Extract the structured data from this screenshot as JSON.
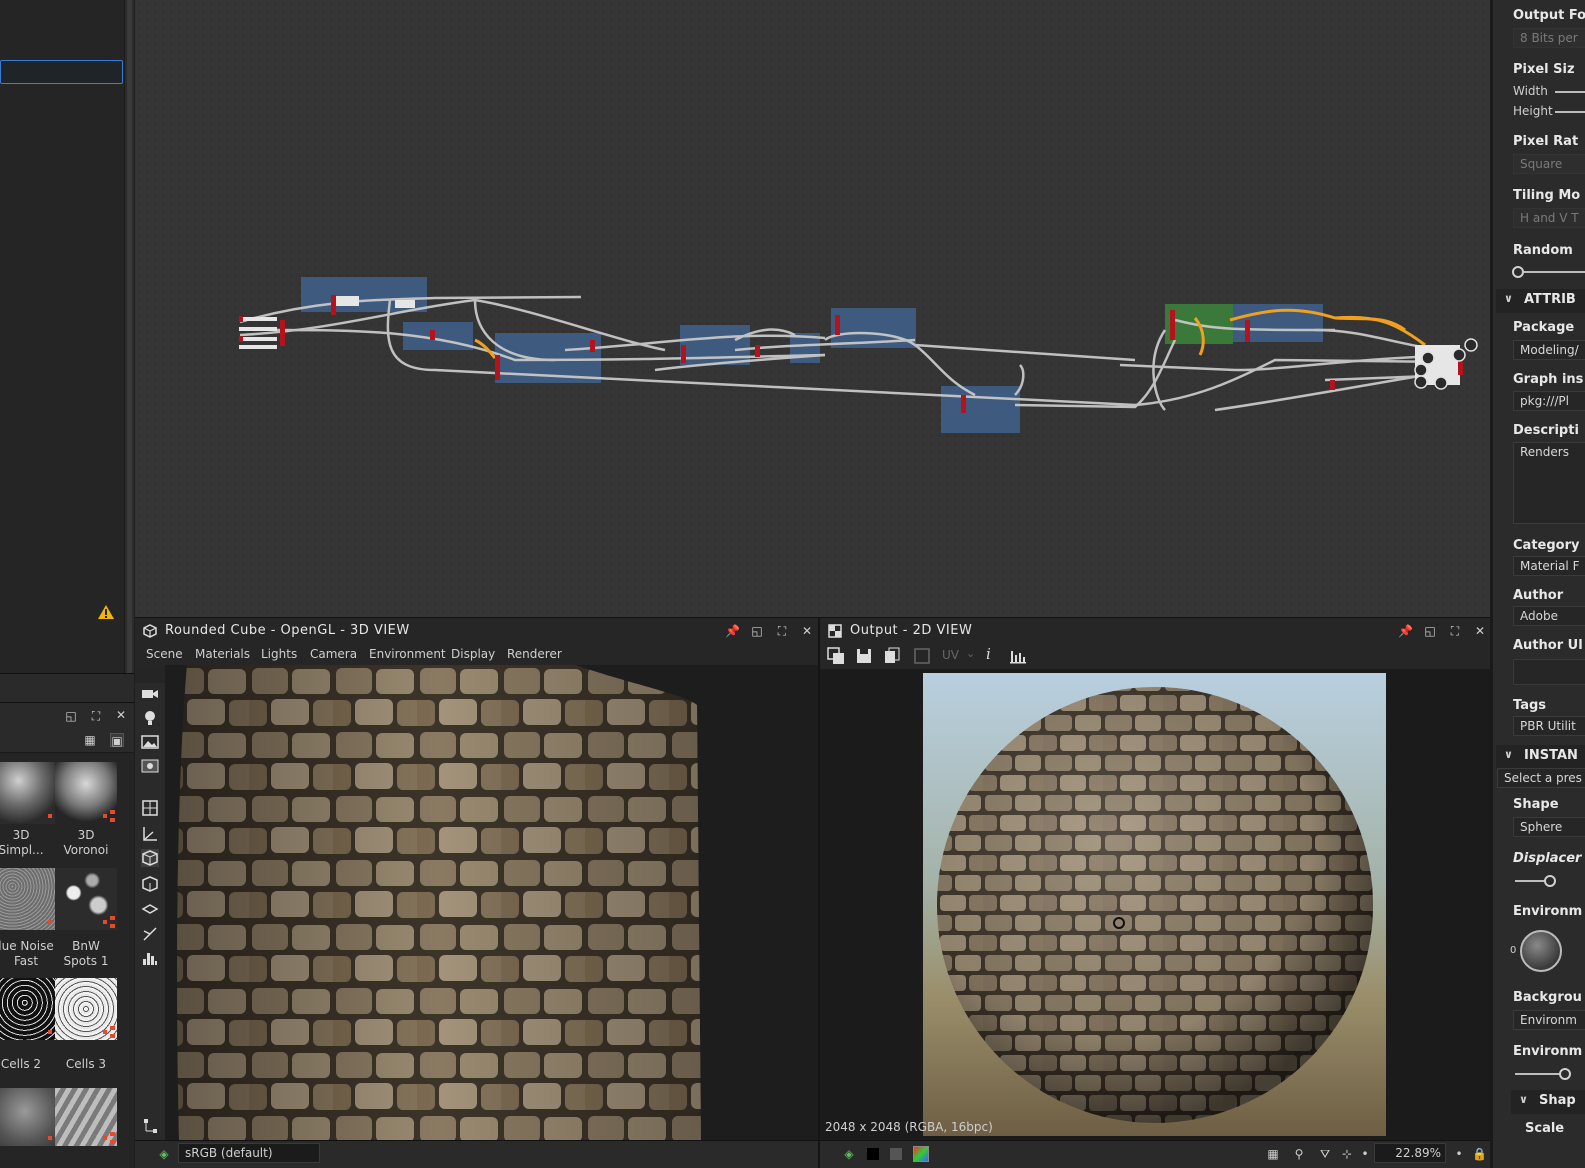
{
  "left_panel": {
    "warning_icon": "warning-triangle-icon",
    "library": {
      "items": [
        {
          "label1": "3D",
          "label2": "Simpl..."
        },
        {
          "label1": "3D",
          "label2": "Voronoi"
        },
        {
          "label1": "lue Noise",
          "label2": "Fast"
        },
        {
          "label1": "BnW",
          "label2": "Spots 1"
        },
        {
          "label1": "Cells 2",
          "label2": ""
        },
        {
          "label1": "Cells 3",
          "label2": ""
        },
        {
          "label1": "",
          "label2": ""
        },
        {
          "label1": "",
          "label2": ""
        }
      ]
    }
  },
  "view3d": {
    "title": "Rounded Cube - OpenGL - 3D VIEW",
    "menu": [
      "Scene",
      "Materials",
      "Lights",
      "Camera",
      "Environment",
      "Display",
      "Renderer"
    ],
    "colorspace": "sRGB (default)"
  },
  "view2d": {
    "title": "Output - 2D VIEW",
    "uv_label": "UV",
    "resolution": "2048 x 2048 (RGBA, 16bpc)",
    "zoom": "22.89%"
  },
  "right_panel": {
    "output_format_label": "Output Fo",
    "output_format_value": "8 Bits per",
    "pixel_size_label": "Pixel Siz",
    "width_label": "Width",
    "height_label": "Height",
    "pixel_ratio_label": "Pixel Rat",
    "pixel_ratio_value": "Square",
    "tiling_label": "Tiling Mo",
    "tiling_value": "H and V T",
    "random_label": "Random",
    "attributes_section": "ATTRIB",
    "package_label": "Package",
    "package_value": "Modeling/",
    "graph_label": "Graph ins",
    "graph_value": "pkg:///Pl",
    "description_label": "Descripti",
    "description_value": "Renders",
    "category_label": "Category",
    "category_value": "Material F",
    "author_label": "Author",
    "author_value": "Adobe",
    "author_url_label": "Author Ul",
    "tags_label": "Tags",
    "tags_value": "PBR Utilit",
    "instance_section": "INSTAN",
    "preset_placeholder": "Select a pres",
    "shape_label": "Shape",
    "shape_value": "Sphere",
    "displace_label": "Displacer",
    "env_label1": "Environm",
    "env_dial_value": "0",
    "background_label": "Backgrou",
    "background_value": "Environm",
    "env_label2": "Environm",
    "shape_section": "Shap",
    "scale_label": "Scale"
  },
  "colors": {
    "accent_blue": "#3a7bd5",
    "frame_blue": "#3f5f87",
    "frame_green": "#3b7d3a",
    "wire_gray": "#c8c8c8",
    "wire_orange": "#f0a020"
  }
}
